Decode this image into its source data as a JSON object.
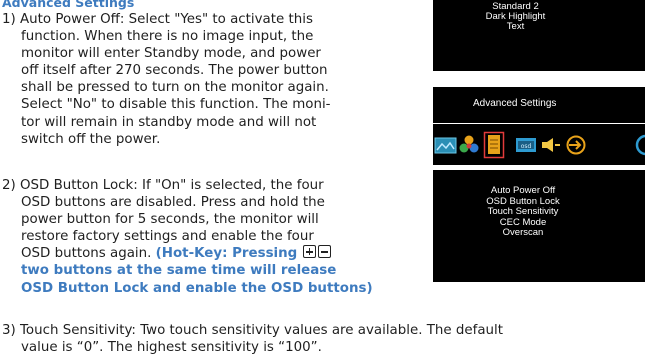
{
  "section_heading": "Advanced Settings",
  "item1": {
    "lines": [
      "1) Auto Power Off: Select \"Yes\" to activate this",
      "function. When there is no image input, the",
      "monitor will enter Standby mode, and power",
      "off itself after 270 seconds. The power button",
      "shall be pressed to turn on the monitor again.",
      "Select \"No\" to disable this function. The moni-",
      "tor will remain in standby mode and will not",
      "switch off the power."
    ]
  },
  "item2": {
    "lines": [
      "2) OSD Button Lock: If \"On\" is selected, the four",
      "OSD buttons are disabled. Press and hold the",
      "power button for 5 seconds, the monitor will",
      "restore  factory settings and enable the four"
    ],
    "line5": "OSD buttons again.",
    "hotkey_1": "(Hot-Key: Pressing",
    "hotkey_2": "two buttons at the same time will release",
    "hotkey_3": "OSD Button Lock and enable the OSD buttons)"
  },
  "item3": {
    "line1": "3) Touch Sensitivity: Two touch sensitivity values are available. The default",
    "line2": "value is “0”. The highest sensitivity is “100”."
  },
  "osd_top_menu": {
    "items": [
      "Standard 2",
      "Dark Highlight",
      "Text"
    ]
  },
  "osd_advanced": {
    "title": "Advanced Settings",
    "icons": [
      "image-icon",
      "color-icon",
      "document-icon",
      "osd-icon",
      "audio-icon",
      "input-icon",
      "partial-icon"
    ],
    "items": [
      "Auto Power Off",
      "OSD Button Lock",
      "Touch Sensitivity",
      "CEC Mode",
      "Overscan"
    ]
  },
  "colors": {
    "heading_blue": "#3e7bbf",
    "panel_black": "#000000",
    "highlight_orange": "#e8a21a"
  }
}
